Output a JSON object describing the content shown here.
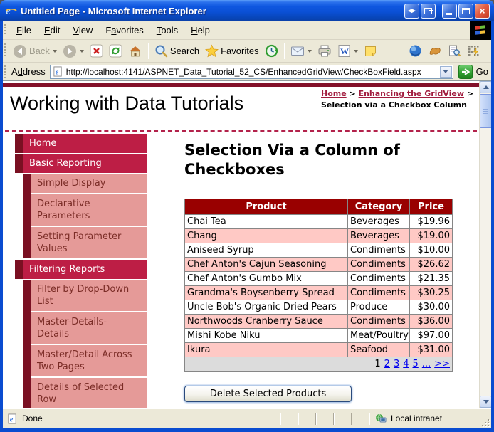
{
  "window": {
    "title": "Untitled Page - Microsoft Internet Explorer"
  },
  "menu": {
    "items": [
      {
        "pre": "",
        "u": "F",
        "post": "ile"
      },
      {
        "pre": "",
        "u": "E",
        "post": "dit"
      },
      {
        "pre": "",
        "u": "V",
        "post": "iew"
      },
      {
        "pre": "F",
        "u": "a",
        "post": "vorites"
      },
      {
        "pre": "",
        "u": "T",
        "post": "ools"
      },
      {
        "pre": "",
        "u": "H",
        "post": "elp"
      }
    ]
  },
  "toolbar": {
    "back_label": "Back",
    "search_label": "Search",
    "favorites_label": "Favorites"
  },
  "address": {
    "label_pre": "A",
    "label_u": "d",
    "label_post": "dress",
    "url": "http://localhost:4141/ASPNET_Data_Tutorial_52_CS/EnhancedGridView/CheckBoxField.aspx",
    "go_label": "Go"
  },
  "site": {
    "title": "Working with Data Tutorials",
    "breadcrumb": {
      "home": "Home",
      "sep1": " > ",
      "section": "Enhancing the GridView",
      "sep2": " > ",
      "current": "Selection via a Checkbox Column"
    }
  },
  "sidebar": {
    "items": [
      {
        "label": "Home"
      },
      {
        "label": "Basic Reporting"
      },
      {
        "label": "Simple Display"
      },
      {
        "label": "Declarative Parameters"
      },
      {
        "label": "Setting Parameter Values"
      },
      {
        "label": "Filtering Reports"
      },
      {
        "label": "Filter by Drop-Down List"
      },
      {
        "label": "Master-Details-Details"
      },
      {
        "label": "Master/Detail Across Two Pages"
      },
      {
        "label": "Details of Selected Row"
      }
    ]
  },
  "main": {
    "heading": "Selection Via a Column of Checkboxes",
    "table": {
      "headers": [
        "Product",
        "Category",
        "Price"
      ],
      "rows": [
        {
          "product": "Chai Tea",
          "category": "Beverages",
          "price": "$19.96"
        },
        {
          "product": "Chang",
          "category": "Beverages",
          "price": "$19.00"
        },
        {
          "product": "Aniseed Syrup",
          "category": "Condiments",
          "price": "$10.00"
        },
        {
          "product": "Chef Anton's Cajun Seasoning",
          "category": "Condiments",
          "price": "$26.62"
        },
        {
          "product": "Chef Anton's Gumbo Mix",
          "category": "Condiments",
          "price": "$21.35"
        },
        {
          "product": "Grandma's Boysenberry Spread",
          "category": "Condiments",
          "price": "$30.25"
        },
        {
          "product": "Uncle Bob's Organic Dried Pears",
          "category": "Produce",
          "price": "$30.00"
        },
        {
          "product": "Northwoods Cranberry Sauce",
          "category": "Condiments",
          "price": "$36.00"
        },
        {
          "product": "Mishi Kobe Niku",
          "category": "Meat/Poultry",
          "price": "$97.00"
        },
        {
          "product": "Ikura",
          "category": "Seafood",
          "price": "$31.00"
        }
      ],
      "pager": {
        "current": "1",
        "pages": [
          "2",
          "3",
          "4",
          "5"
        ],
        "ellipsis": "...",
        "next": ">>"
      }
    },
    "delete_button": "Delete Selected Products"
  },
  "statusbar": {
    "status": "Done",
    "zone": "Local intranet"
  },
  "icons": {
    "close_glyph": "×",
    "screen_toggle_glyph": "◀▶",
    "word_glyph": "W",
    "ie_glyph": "e"
  },
  "colors": {
    "accent_crimson": "#bd1e45",
    "dark_maroon": "#7a1022",
    "top_rule_maroon": "#831029",
    "table_header_red": "#990000",
    "alt_row_pink": "#ffc9c5",
    "pager_bg": "#dcdcdc",
    "link_blue": "#0000ee",
    "breadcrumb_link": "#a11c3e",
    "titlebar_blue": "#0b50d6"
  }
}
